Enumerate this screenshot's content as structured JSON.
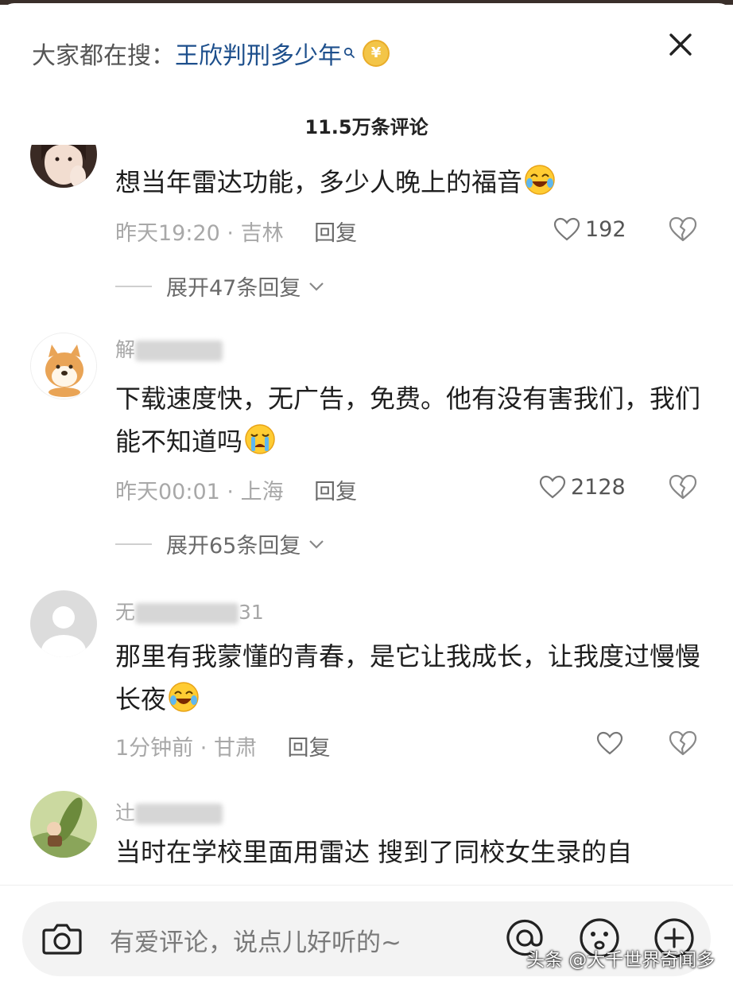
{
  "header": {
    "search_prefix": "大家都在搜：",
    "search_term": "王欣判刑多少年",
    "coin_symbol": "¥",
    "close_icon": "close-icon"
  },
  "comment_count": "11.5万条评论",
  "comments": [
    {
      "text": "想当年雷达功能，多少人晚上的福音",
      "emoji": "laughing-crying-emoji",
      "time": "昨天19:20",
      "location": "吉林",
      "reply_label": "回复",
      "likes": "192",
      "expand_label": "展开47条回复"
    },
    {
      "username_visible": "解",
      "text": "下载速度快，无广告，免费。他有没有害我们，我们能不知道吗",
      "emoji": "crying-emoji",
      "time": "昨天00:01",
      "location": "上海",
      "reply_label": "回复",
      "likes": "2128",
      "expand_label": "展开65条回复"
    },
    {
      "username_visible": "无",
      "username_tail": "31",
      "text": "那里有我蒙懂的青春，是它让我成长，让我度过慢慢长夜",
      "emoji": "laughing-crying-emoji",
      "time": "1分钟前",
      "location": "甘肃",
      "reply_label": "回复",
      "likes": ""
    },
    {
      "username_visible": "辻",
      "text": "当时在学校里面用雷达 搜到了同校女生录的自"
    }
  ],
  "input": {
    "placeholder": "有爱评论，说点儿好听的~"
  },
  "watermark": "头条 @大千世界奇闻多",
  "colors": {
    "search_term": "#1d4f8c",
    "meta": "#a8a8a8",
    "coin": "#f3c548"
  }
}
